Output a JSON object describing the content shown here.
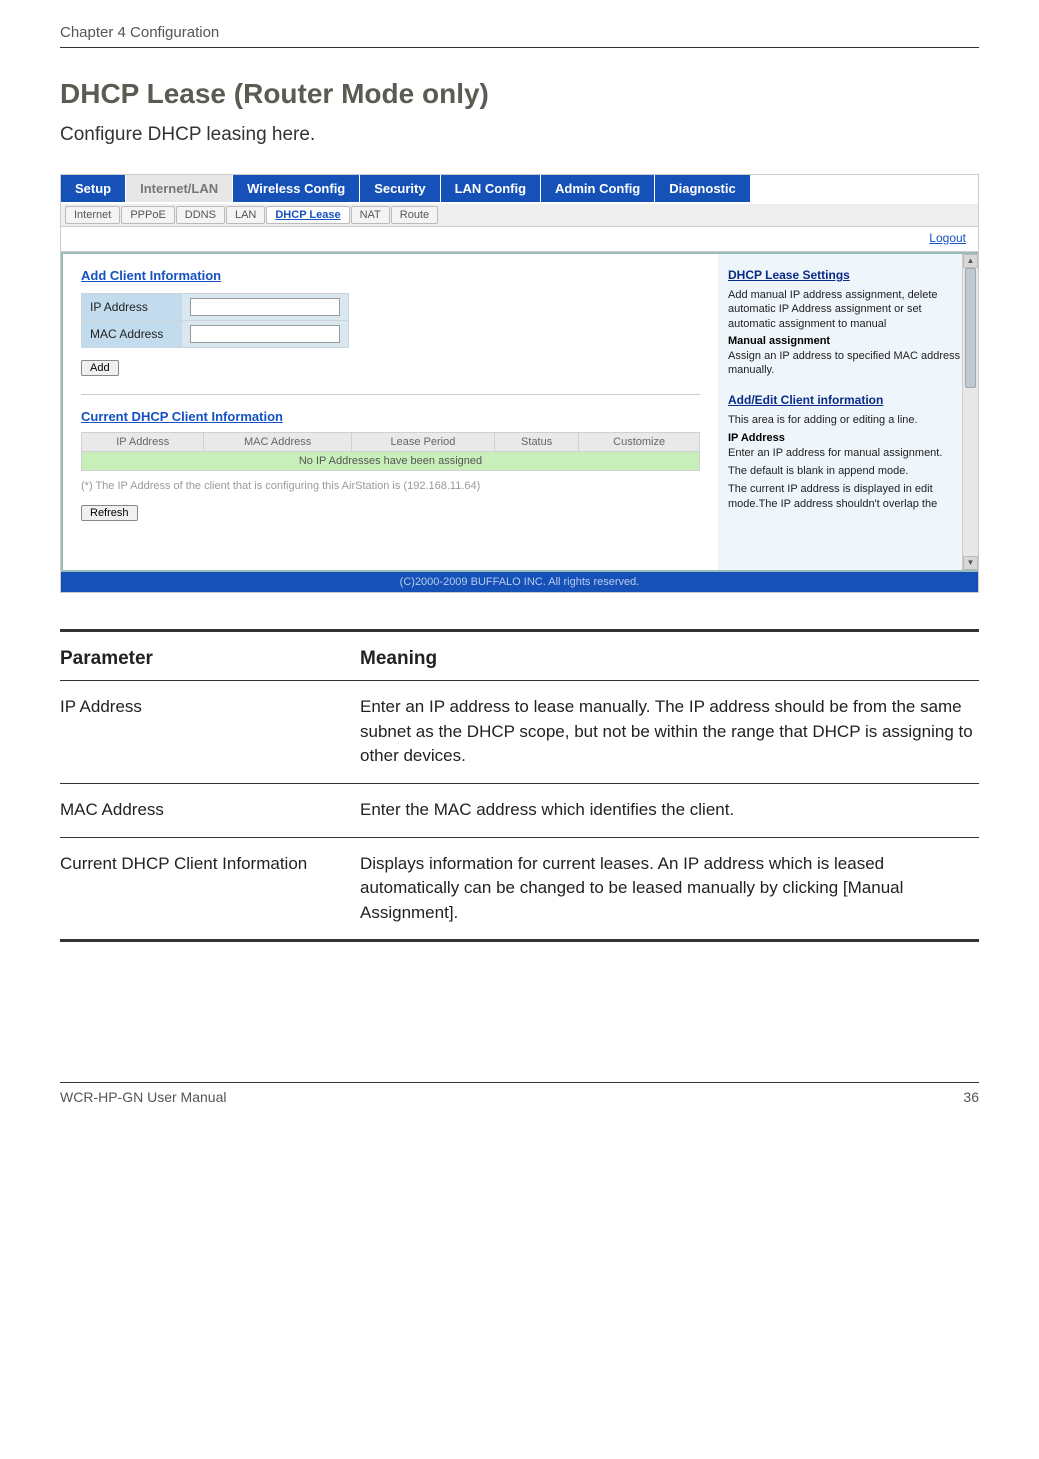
{
  "header": {
    "chapter": "Chapter 4  Configuration"
  },
  "section": {
    "title": "DHCP Lease (Router Mode only)",
    "intro": "Configure DHCP leasing here."
  },
  "screenshot": {
    "tabs": [
      "Setup",
      "Internet/LAN",
      "Wireless Config",
      "Security",
      "LAN Config",
      "Admin Config",
      "Diagnostic"
    ],
    "active_tab_index": 1,
    "subtabs": [
      "Internet",
      "PPPoE",
      "DDNS",
      "LAN",
      "DHCP Lease",
      "NAT",
      "Route"
    ],
    "active_subtab_index": 4,
    "logout": "Logout",
    "left": {
      "add_heading": "Add Client Information",
      "ip_label": "IP Address",
      "mac_label": "MAC Address",
      "ip_value": "",
      "mac_value": "",
      "add_btn": "Add",
      "current_heading": "Current DHCP Client Information",
      "cols": [
        "IP Address",
        "MAC Address",
        "Lease Period",
        "Status",
        "Customize"
      ],
      "empty_row": "No IP Addresses have been assigned",
      "note": "(*) The IP Address of the client that is configuring this AirStation is (192.168.11.64)",
      "refresh_btn": "Refresh"
    },
    "right": {
      "h1": "DHCP Lease Settings",
      "p1": "Add manual IP address assignment, delete automatic IP Address assignment or set automatic assignment to manual",
      "sub1": "Manual assignment",
      "p2": "Assign an IP address to specified MAC address manually.",
      "h2": "Add/Edit Client information",
      "p3": "This area is for adding or editing a line.",
      "sub2": "IP Address",
      "p4": "Enter an IP address for manual assignment.",
      "p5": "The default is blank in append mode.",
      "p6": "The current IP address is displayed in edit mode.The IP address shouldn't overlap the"
    },
    "footer": "(C)2000-2009 BUFFALO INC. All rights reserved."
  },
  "param_table": {
    "head_param": "Parameter",
    "head_meaning": "Meaning",
    "rows": [
      {
        "param": "IP Address",
        "meaning": "Enter an IP address to lease manually. The IP address should be from the same subnet as the DHCP scope, but not be within the range that DHCP is assigning to other devices."
      },
      {
        "param": "MAC Address",
        "meaning": "Enter the MAC address which identifies the client."
      },
      {
        "param": "Current DHCP Client Information",
        "meaning": "Displays information for current leases. An IP address which is leased automatically can be changed to be leased manually by clicking [Manual Assignment]."
      }
    ]
  },
  "doc_footer": {
    "left": "WCR-HP-GN User Manual",
    "right": "36"
  }
}
